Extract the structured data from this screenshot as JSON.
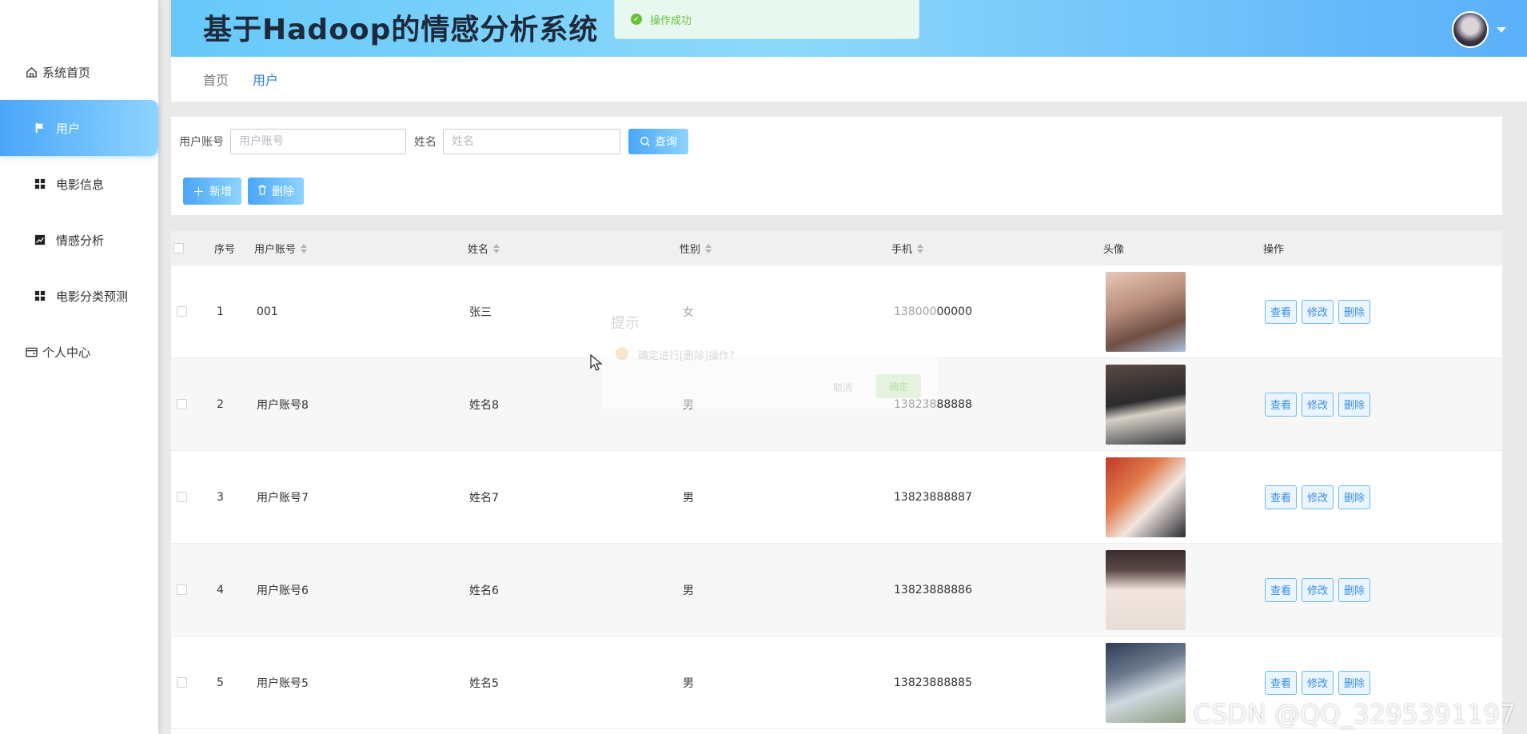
{
  "header": {
    "title": "基于Hadoop的情感分析系统"
  },
  "toast": {
    "message": "操作成功"
  },
  "sidebar": {
    "items": [
      {
        "label": "系统首页",
        "icon": "home-icon"
      },
      {
        "label": "用户",
        "icon": "flag-icon",
        "active": true
      },
      {
        "label": "电影信息",
        "icon": "grid-icon"
      },
      {
        "label": "情感分析",
        "icon": "chart-icon"
      },
      {
        "label": "电影分类预测",
        "icon": "grid-icon"
      },
      {
        "label": "个人中心",
        "icon": "card-icon"
      }
    ]
  },
  "breadcrumb": {
    "home": "首页",
    "current": "用户"
  },
  "search": {
    "account_label": "用户账号",
    "account_placeholder": "用户账号",
    "name_label": "姓名",
    "name_placeholder": "姓名",
    "query_label": "查询"
  },
  "actions": {
    "add_label": "新增",
    "delete_label": "删除"
  },
  "table": {
    "columns": {
      "index": "序号",
      "account": "用户账号",
      "name": "姓名",
      "gender": "性别",
      "phone": "手机",
      "avatar": "头像",
      "ops": "操作"
    },
    "op_labels": {
      "view": "查看",
      "edit": "修改",
      "delete": "删除"
    },
    "rows": [
      {
        "index": "1",
        "account": "001",
        "name": "张三",
        "gender": "女",
        "phone": "13800000000"
      },
      {
        "index": "2",
        "account": "用户账号8",
        "name": "姓名8",
        "gender": "男",
        "phone": "13823888888"
      },
      {
        "index": "3",
        "account": "用户账号7",
        "name": "姓名7",
        "gender": "男",
        "phone": "13823888887"
      },
      {
        "index": "4",
        "account": "用户账号6",
        "name": "姓名6",
        "gender": "男",
        "phone": "13823888886"
      },
      {
        "index": "5",
        "account": "用户账号5",
        "name": "姓名5",
        "gender": "男",
        "phone": "13823888885"
      }
    ]
  },
  "dialog": {
    "title": "提示",
    "message": "确定进行[删除]操作?",
    "cancel": "取消",
    "confirm": "确定"
  },
  "watermark": "CSDN @QQ_3295391197",
  "colors": {
    "accent": "#4aa6f8",
    "accent_light": "#8dd4ff",
    "success": "#67c23a"
  }
}
